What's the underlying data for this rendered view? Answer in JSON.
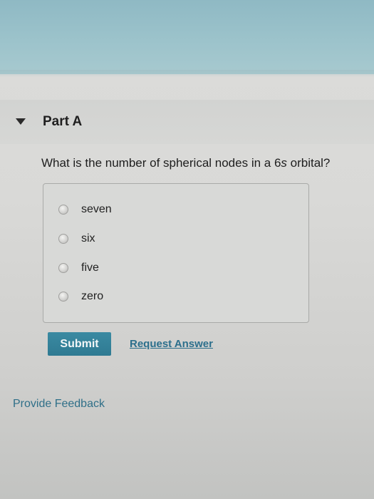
{
  "part": {
    "title": "Part A"
  },
  "question": {
    "text_before": "What is the number of spherical nodes in a 6",
    "text_var": "s",
    "text_after": " orbital?"
  },
  "options": [
    {
      "label": "seven",
      "selected": false
    },
    {
      "label": "six",
      "selected": false
    },
    {
      "label": "five",
      "selected": false
    },
    {
      "label": "zero",
      "selected": false
    }
  ],
  "actions": {
    "submit_label": "Submit",
    "request_answer_label": "Request Answer"
  },
  "footer": {
    "feedback_label": "Provide Feedback"
  },
  "colors": {
    "banner": "#9cc3cb",
    "submit_button": "#3a8aa2",
    "link": "#2c6f8c"
  },
  "icons": {
    "collapse_toggle": "triangle-down-icon",
    "radio": "radio-button-icon"
  }
}
